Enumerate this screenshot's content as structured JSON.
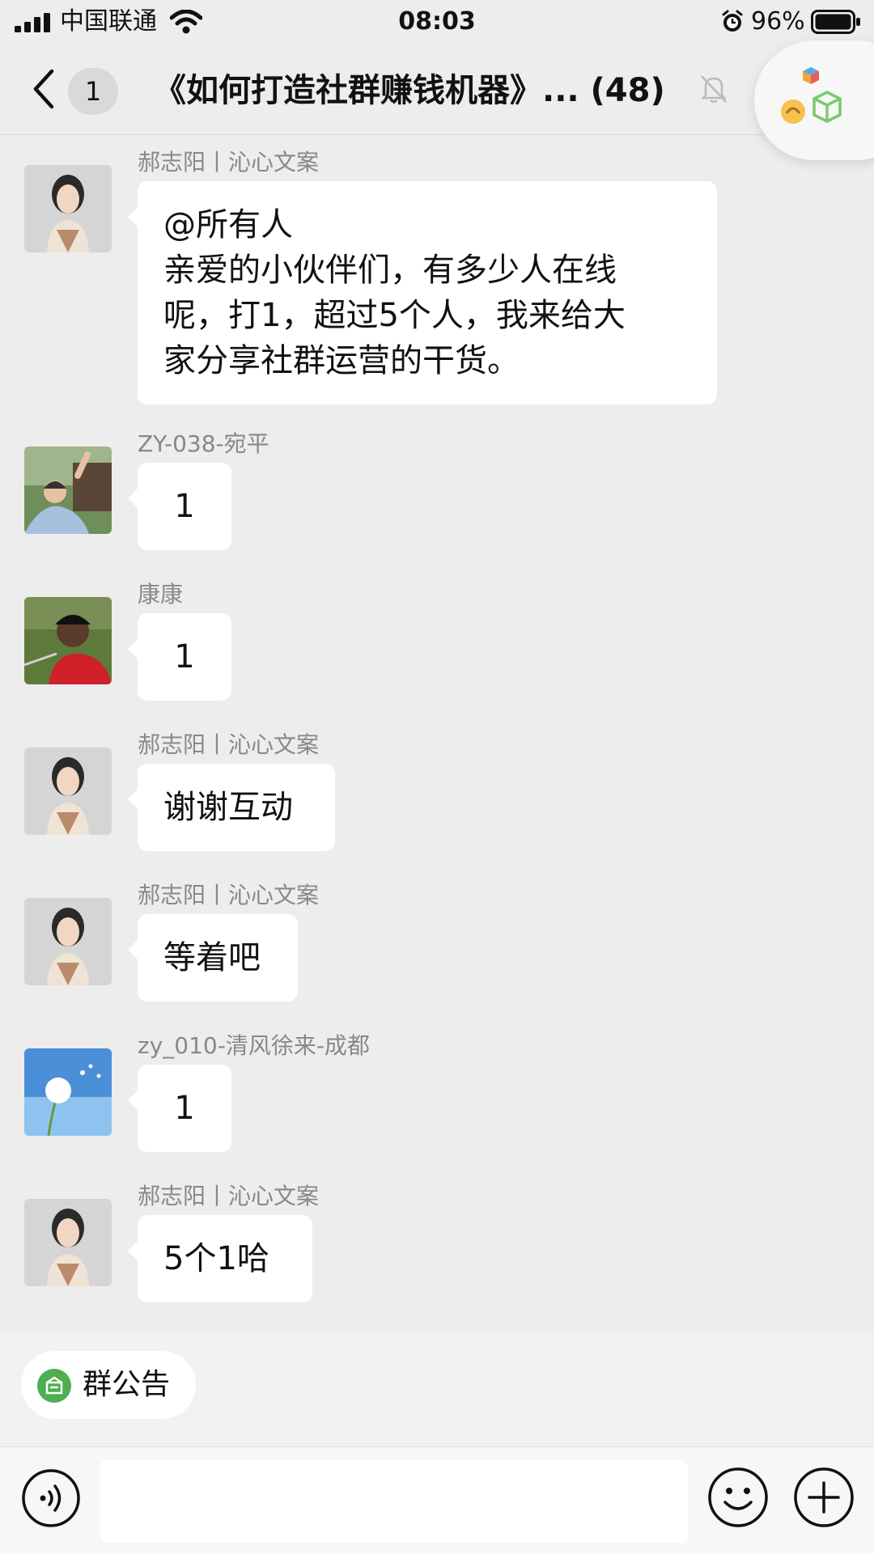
{
  "status_bar": {
    "carrier": "中国联通",
    "time": "08:03",
    "battery_percent": "96%"
  },
  "nav": {
    "unread_count": "1",
    "title": "《如何打造社群赚钱机器》... (48)"
  },
  "messages": [
    {
      "sender": "郝志阳丨沁心文案",
      "avatar": "woman-portrait",
      "lines": [
        "@所有人",
        "亲爱的小伙伴们，有多少人在线",
        "呢，打1，超过5个人，我来给大",
        "家分享社群运营的干货。"
      ]
    },
    {
      "sender": "ZY-038-宛平",
      "avatar": "outdoor-person",
      "lines": [
        "1"
      ]
    },
    {
      "sender": "康康",
      "avatar": "golfer",
      "lines": [
        "1"
      ]
    },
    {
      "sender": "郝志阳丨沁心文案",
      "avatar": "woman-portrait",
      "lines": [
        "谢谢互动"
      ]
    },
    {
      "sender": "郝志阳丨沁心文案",
      "avatar": "woman-portrait",
      "lines": [
        "等着吧"
      ]
    },
    {
      "sender": "zy_010-清风徐来-成都",
      "avatar": "dandelion",
      "lines": [
        "1"
      ]
    },
    {
      "sender": "郝志阳丨沁心文案",
      "avatar": "woman-portrait",
      "lines": [
        "5个1哈"
      ]
    }
  ],
  "notice": {
    "label": "群公告"
  },
  "input": {
    "value": ""
  },
  "icons": {
    "back": "chevron-left-icon",
    "mute": "bell-slash-icon",
    "mini_program": "mini-program-icon",
    "voice": "voice-icon",
    "emoji": "emoji-icon",
    "plus": "plus-icon"
  },
  "colors": {
    "background": "#ededed",
    "bubble": "#ffffff",
    "sender_text": "#888888",
    "notice_icon": "#4caf50"
  }
}
